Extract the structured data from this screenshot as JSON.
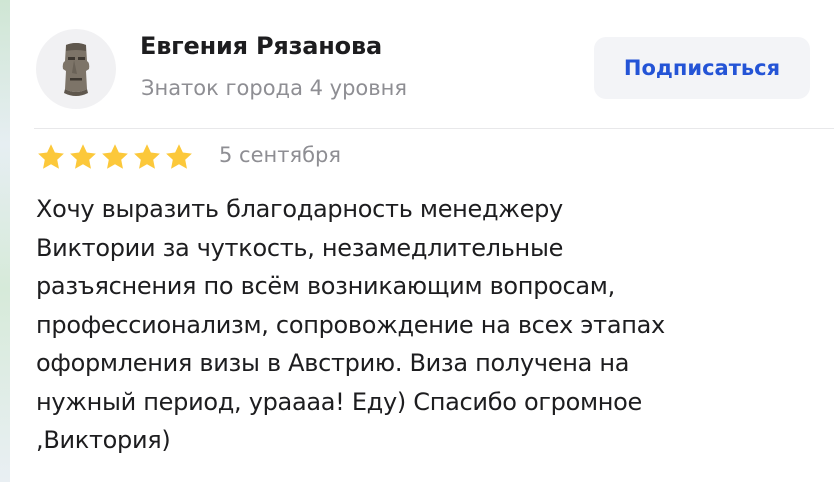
{
  "author": {
    "name": "Евгения Рязанова",
    "level": "Знаток города 4 уровня",
    "avatar_icon": "moai-statue-icon"
  },
  "subscribe_label": "Подписаться",
  "review": {
    "rating": 5,
    "max_rating": 5,
    "date": "5 сентября",
    "lines": [
      "Хочу выразить благодарность менеджеру",
      "Виктории за чуткость, незамедлительные",
      "разъяснения по всём возникающим вопросам,",
      "профессионализм, сопровождение на всех этапах",
      "оформления визы в Австрию. Виза получена на",
      "нужный период, ураааа! Еду) Спасибо огромное",
      ",Виктория)"
    ]
  },
  "colors": {
    "accent": "#2454d6",
    "star": "#fcc83a",
    "muted_text": "#8e8e93",
    "button_bg": "#f3f4f7"
  }
}
